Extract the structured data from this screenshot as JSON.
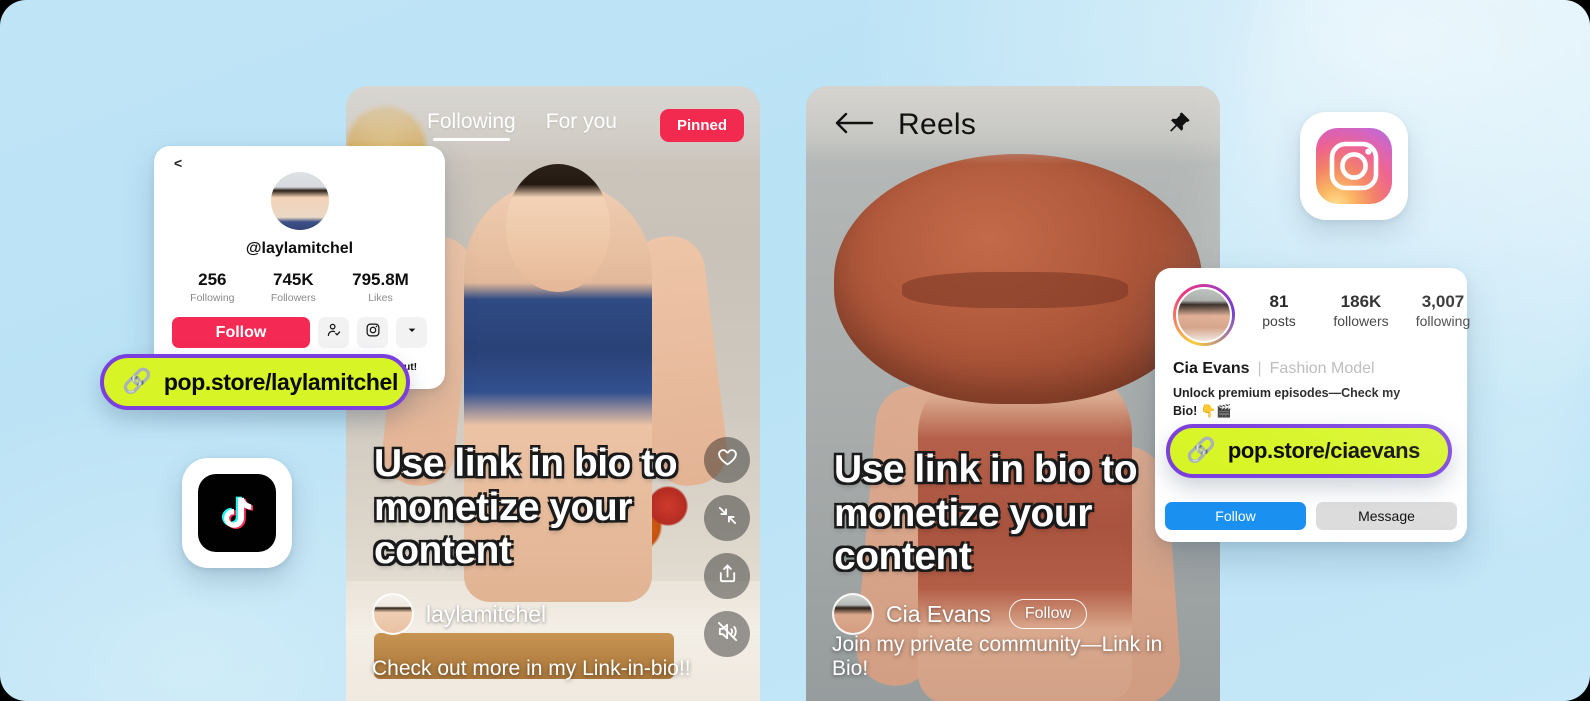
{
  "background": {
    "color": "#bfe4f6"
  },
  "brand_colors": {
    "tiktok_red": "#f52a54",
    "instagram_blue": "#1a90f0",
    "pill_green": "#d7f526",
    "pill_border_purple": "#7b3fdd"
  },
  "tiktok_profile_card": {
    "back_icon": "back-chevron-icon",
    "handle": "@laylamitchel",
    "stats": [
      {
        "value": "256",
        "label": "Following"
      },
      {
        "value": "745K",
        "label": "Followers"
      },
      {
        "value": "795.8M",
        "label": "Likes"
      }
    ],
    "follow_label": "Follow",
    "icon_buttons": [
      {
        "name": "add-friend-icon"
      },
      {
        "name": "instagram-icon"
      },
      {
        "name": "chevron-down-icon"
      }
    ],
    "bio": "Full repisodes available in my bio—check it out!"
  },
  "tiktok_link_pill": {
    "emoji": "🔗",
    "text": "pop.store/laylamitchel"
  },
  "tiktok_feed": {
    "tabs": [
      {
        "label": "Following",
        "active": true
      },
      {
        "label": "For you",
        "active": false
      }
    ],
    "pinned_badge": "Pinned",
    "overlay_caption": "Use link in bio to monetize your content",
    "author": "laylamitchel",
    "video_caption": "Check out more in my Link-in-bio!!",
    "actions": [
      {
        "name": "heart-icon"
      },
      {
        "name": "collapse-arrows-icon"
      },
      {
        "name": "share-icon"
      },
      {
        "name": "mute-icon"
      }
    ]
  },
  "reels_feed": {
    "back_icon": "back-arrow-icon",
    "title": "Reels",
    "pin_icon": "pushpin-icon",
    "overlay_caption": "Use link in bio to monetize your content",
    "author": "Cia Evans",
    "follow_label": "Follow",
    "video_caption": "Join my private community—Link in Bio!"
  },
  "instagram_profile_card": {
    "stats": [
      {
        "value": "81",
        "label": "posts"
      },
      {
        "value": "186K",
        "label": "followers"
      },
      {
        "value": "3,007",
        "label": "following"
      }
    ],
    "name": "Cia Evans",
    "divider": "|",
    "category": "Fashion Model",
    "bio": "Unlock premium episodes—Check my Bio! 👇🎬",
    "follow_label": "Follow",
    "message_label": "Message"
  },
  "instagram_link_pill": {
    "emoji": "🔗",
    "text": "pop.store/ciaevans"
  },
  "app_badges": [
    {
      "name": "instagram-app-icon"
    },
    {
      "name": "tiktok-app-icon"
    }
  ]
}
